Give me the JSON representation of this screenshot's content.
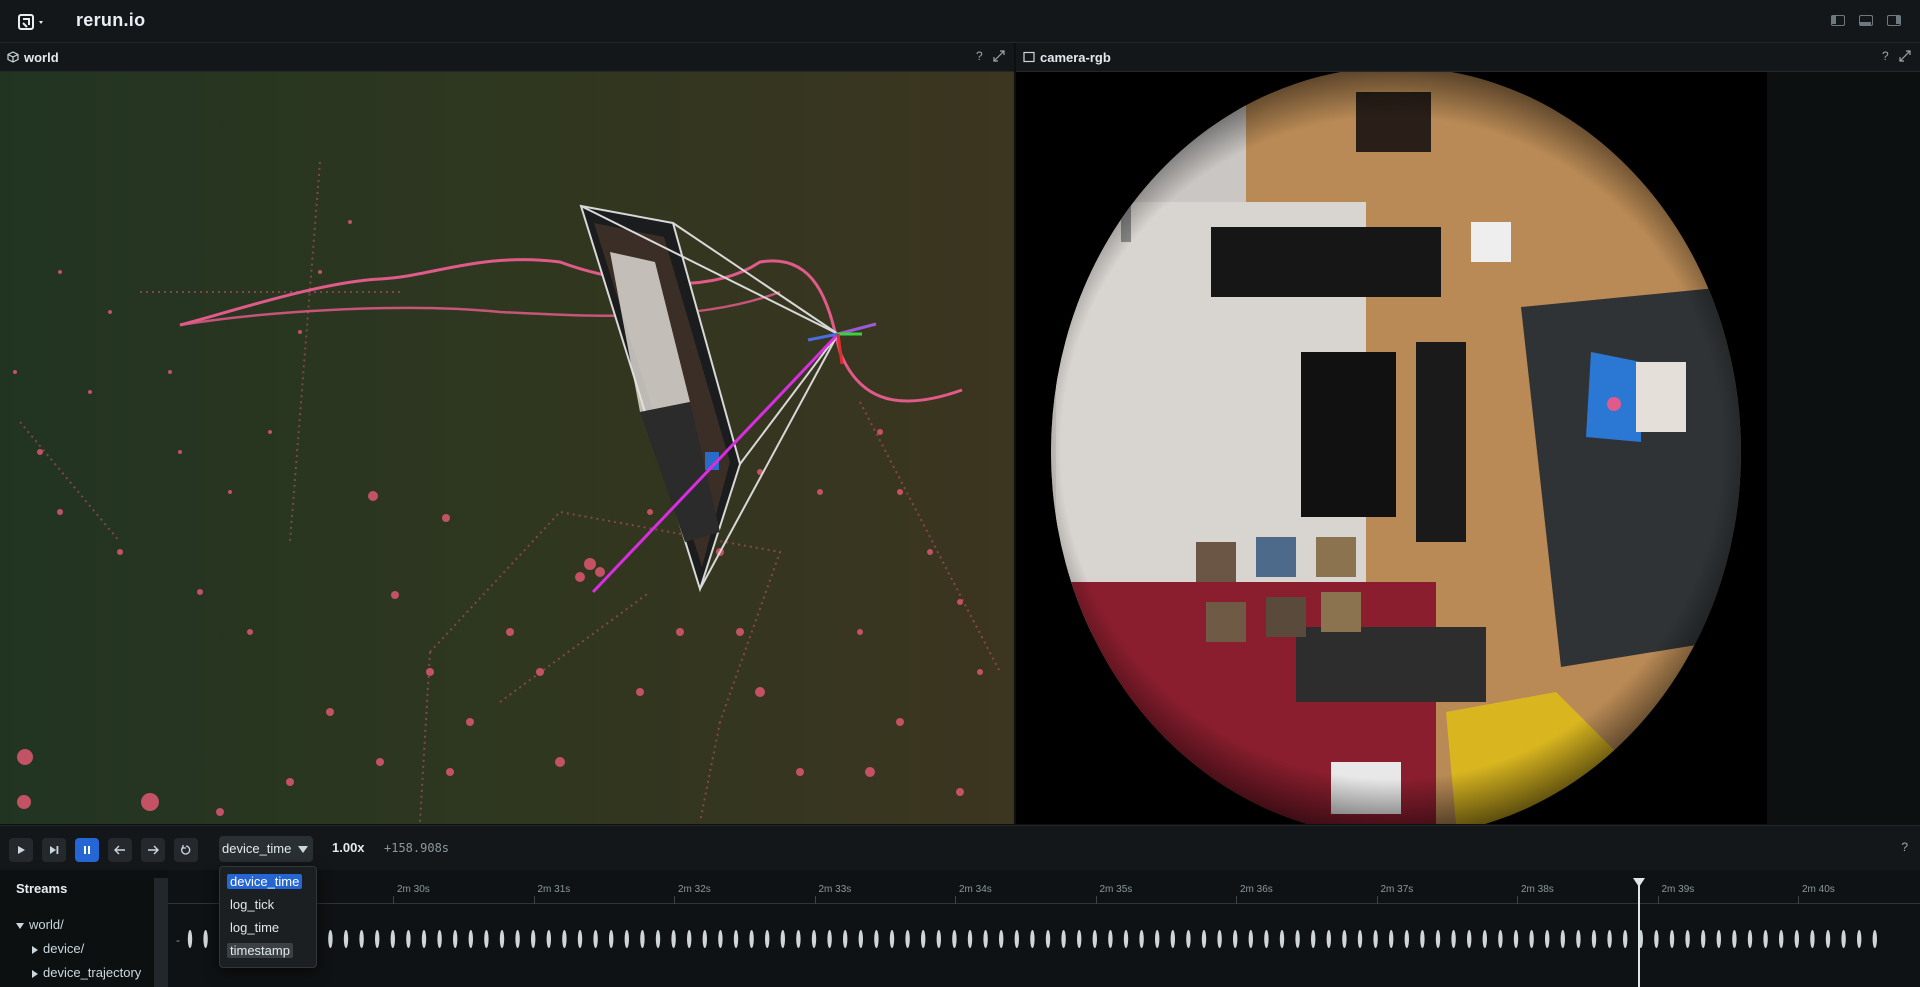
{
  "app": {
    "title": "rerun.io",
    "logo_icon": "rerun-logo-icon"
  },
  "views": {
    "world": {
      "title": "world",
      "help": "?"
    },
    "camera": {
      "title": "camera-rgb",
      "help": "?"
    }
  },
  "timeline": {
    "selected": "device_time",
    "speed": "1.00x",
    "offset": "+158.908s",
    "help": "?",
    "options": [
      "device_time",
      "log_tick",
      "log_time",
      "timestamp"
    ]
  },
  "streams": {
    "title": "Streams",
    "items": [
      {
        "label": "world/",
        "expanded": true
      },
      {
        "label": "device/",
        "expanded": false
      },
      {
        "label": "device_trajectory",
        "expanded": false
      }
    ]
  },
  "time_axis": {
    "ticks": [
      "2m 30s",
      "2m 31s",
      "2m 32s",
      "2m 33s",
      "2m 34s",
      "2m 35s",
      "2m 36s",
      "2m 37s",
      "2m 38s",
      "2m 39s",
      "2m 40s"
    ],
    "minus_marker": "-"
  },
  "colors": {
    "accent": "#2466d4",
    "point": "#d4566c",
    "trajectory": "#e05a8a",
    "ray": "#d62ee0"
  }
}
